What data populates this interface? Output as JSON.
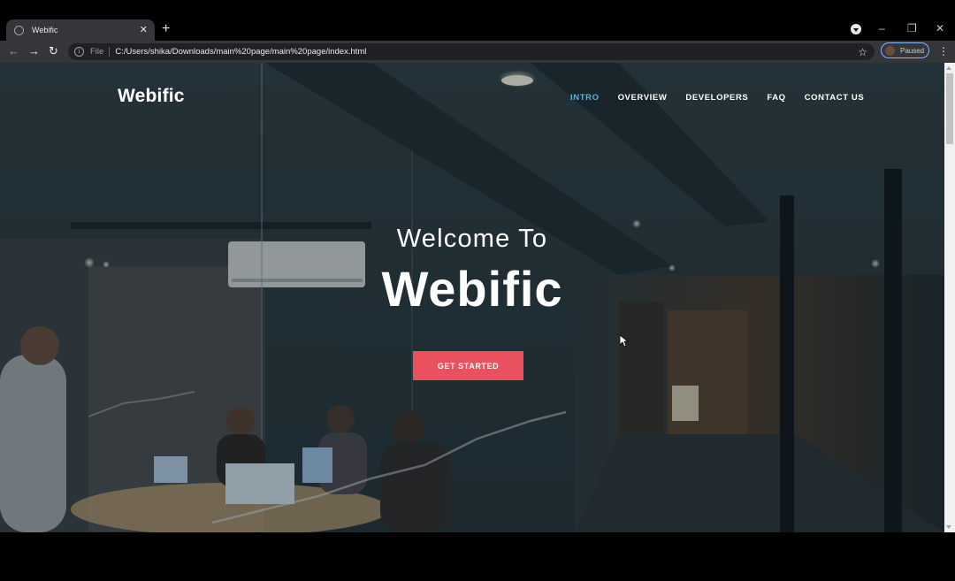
{
  "browser": {
    "tab_title": "Webific",
    "tab_close": "✕",
    "new_tab": "+",
    "omnibox_scheme": "File",
    "url": "C:/Users/shika/Downloads/main%20page/main%20page/index.html",
    "profile_status": "Paused",
    "icons": [
      "back-icon",
      "forward-icon",
      "reload-icon",
      "info-icon",
      "star-icon",
      "kebab-menu-icon",
      "minimize-icon",
      "restore-icon",
      "close-icon"
    ]
  },
  "site": {
    "logo": "Webific",
    "nav": [
      "INTRO",
      "OVERVIEW",
      "DEVELOPERS",
      "FAQ",
      "CONTACT US"
    ],
    "active_nav": "INTRO",
    "hero_subtitle": "Welcome To",
    "hero_title": "Webific",
    "cta_label": "GET STARTED",
    "accent_color": "#e8515d",
    "active_nav_color": "#5ab4e0"
  }
}
